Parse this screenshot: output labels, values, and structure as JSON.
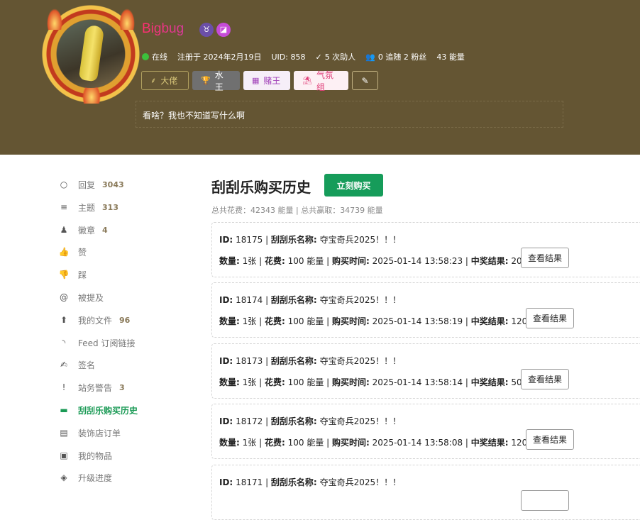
{
  "profile": {
    "username": "Bigbug",
    "status": "在线",
    "registered": "注册于 2024年2月19日",
    "uid": "UID: 858",
    "helped": "5 次助人",
    "follow": "0 追随 2 粉丝",
    "energy": "43 能量",
    "signature": "看啥？我也不知道写什么啊",
    "badge1_icon": "♉",
    "badge2_icon": "◪"
  },
  "tags": [
    {
      "label": "大佬",
      "icon": "⸙"
    },
    {
      "label": "水王",
      "icon": "🏆"
    },
    {
      "label": "赌王",
      "icon": "▦"
    },
    {
      "label": "气氛组",
      "icon": "⛱"
    }
  ],
  "sidebar": {
    "items": [
      {
        "label": "回复",
        "count": "3043",
        "icon": "○"
      },
      {
        "label": "主题",
        "count": "313",
        "icon": "≡"
      },
      {
        "label": "徽章",
        "count": "4",
        "icon": "♟"
      },
      {
        "label": "赞",
        "count": "",
        "icon": "👍"
      },
      {
        "label": "踩",
        "count": "",
        "icon": "👎"
      },
      {
        "label": "被提及",
        "count": "",
        "icon": "@"
      },
      {
        "label": "我的文件",
        "count": "96",
        "icon": "⬆"
      },
      {
        "label": "Feed 订阅链接",
        "count": "",
        "icon": "◝"
      },
      {
        "label": "签名",
        "count": "",
        "icon": "✍"
      },
      {
        "label": "站务警告",
        "count": "3",
        "icon": "!"
      },
      {
        "label": "刮刮乐购买历史",
        "count": "",
        "icon": "▬"
      },
      {
        "label": "装饰店订单",
        "count": "",
        "icon": "▤"
      },
      {
        "label": "我的物品",
        "count": "",
        "icon": "▣"
      },
      {
        "label": "升级进度",
        "count": "",
        "icon": "◈"
      }
    ]
  },
  "main": {
    "title": "刮刮乐购买历史",
    "buy_label": "立刻购买",
    "summary": "总共花费：42343 能量 | 总共赢取：34739 能量",
    "labels": {
      "id": "ID:",
      "name": "刮刮乐名称:",
      "qty": "数量:",
      "cost": "花费:",
      "time": "购买时间:",
      "result": "中奖结果:",
      "view": "查看结果"
    },
    "records": [
      {
        "id": "18175",
        "name": "夺宝奇兵2025！！！",
        "qty": "1张",
        "cost": "100 能量",
        "time": "2025-01-14 13:58:23",
        "result": "20 能量"
      },
      {
        "id": "18174",
        "name": "夺宝奇兵2025！！！",
        "qty": "1张",
        "cost": "100 能量",
        "time": "2025-01-14 13:58:19",
        "result": "120 能量"
      },
      {
        "id": "18173",
        "name": "夺宝奇兵2025！！！",
        "qty": "1张",
        "cost": "100 能量",
        "time": "2025-01-14 13:58:14",
        "result": "50 能量"
      },
      {
        "id": "18172",
        "name": "夺宝奇兵2025！！！",
        "qty": "1张",
        "cost": "100 能量",
        "time": "2025-01-14 13:58:08",
        "result": "120 能量"
      },
      {
        "id": "18171",
        "name": "夺宝奇兵2025！！！",
        "qty": "",
        "cost": "",
        "time": "",
        "result": ""
      }
    ]
  },
  "colors": {
    "header_bg": "#645533",
    "accent_green": "#169c5a",
    "online_dot": "#3cc13c"
  }
}
